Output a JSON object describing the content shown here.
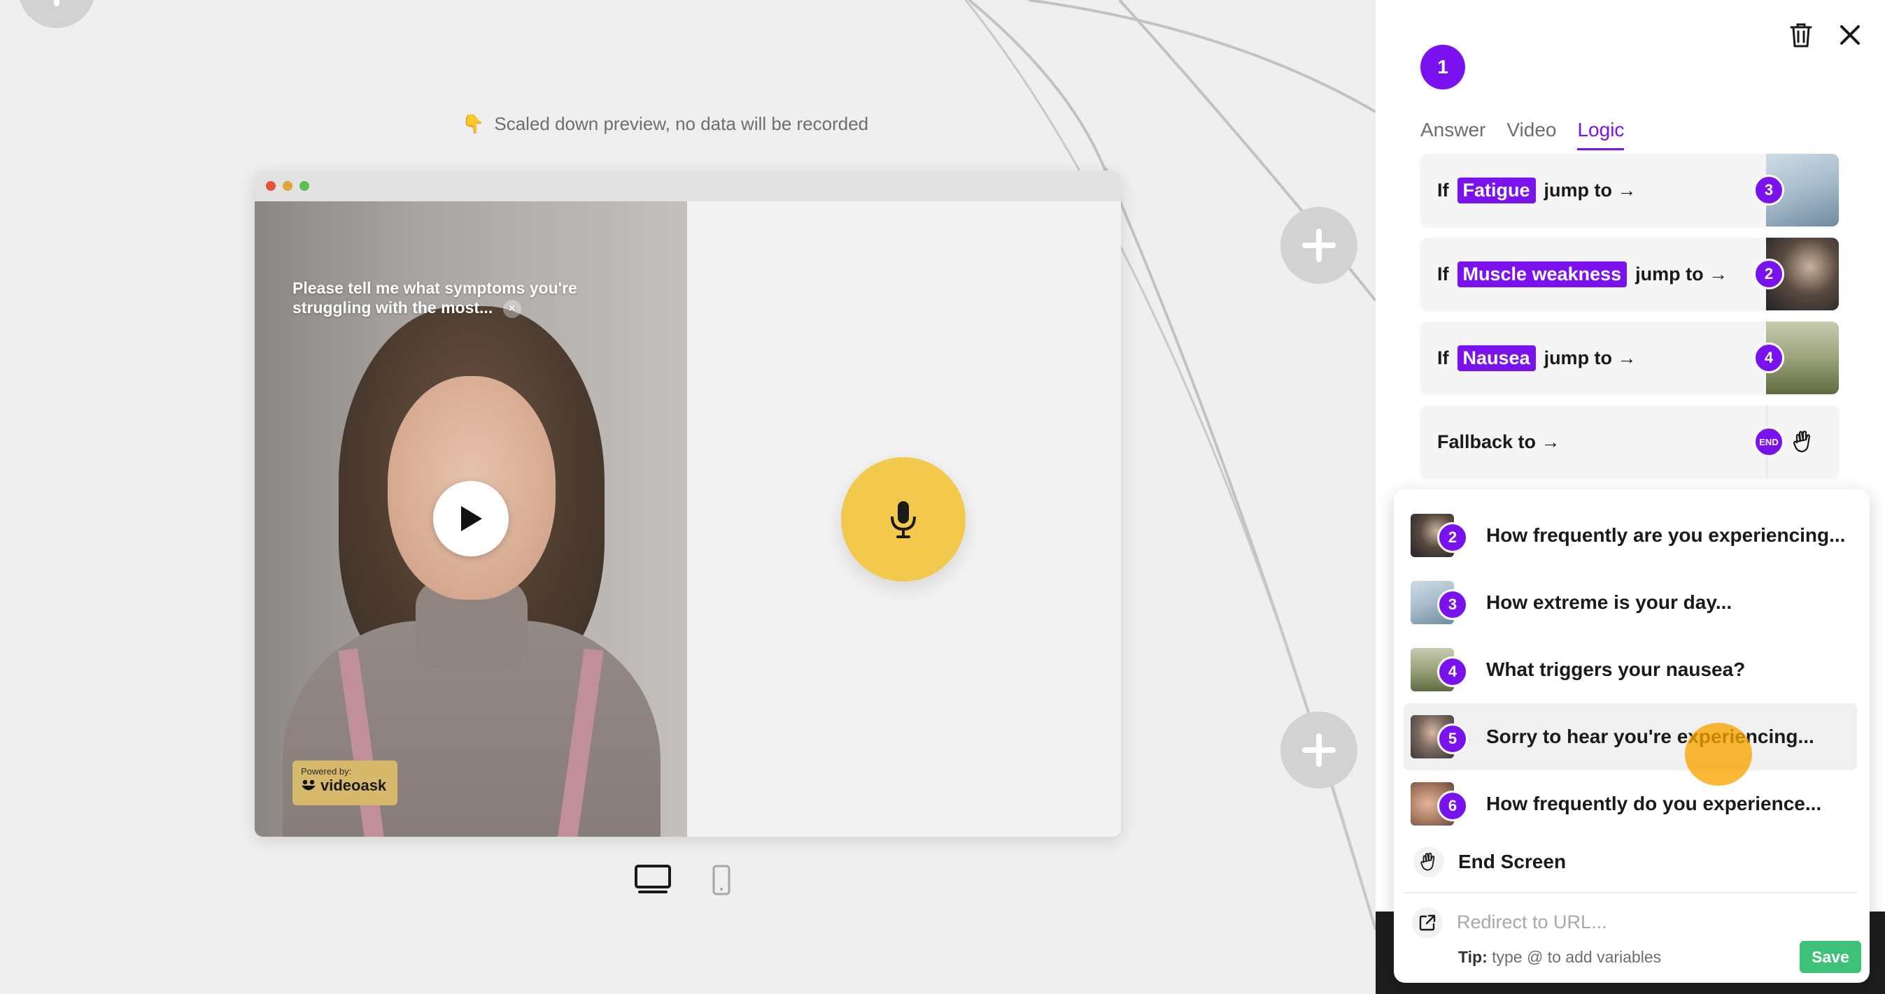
{
  "preview": {
    "note_icon": "pointing-down-hand",
    "note": "Scaled down preview, no data will be recorded",
    "question": "Please tell me what symptoms you're struggling with the most...",
    "question_close": "×",
    "powered_label": "Powered by:",
    "powered_brand": "videoask"
  },
  "panel": {
    "step_number": "1",
    "tabs": [
      {
        "label": "Answer",
        "active": false
      },
      {
        "label": "Video",
        "active": false
      },
      {
        "label": "Logic",
        "active": true
      }
    ],
    "logic_rows": [
      {
        "prefix": "If",
        "condition": "Fatigue",
        "suffix": "jump to →",
        "target": "3"
      },
      {
        "prefix": "If",
        "condition": "Muscle weakness",
        "suffix": "jump to →",
        "target": "2"
      },
      {
        "prefix": "If",
        "condition": "Nausea",
        "suffix": "jump to →",
        "target": "4"
      }
    ],
    "fallback": {
      "label": "Fallback to →",
      "target": "END"
    }
  },
  "dropdown": {
    "items": [
      {
        "number": "2",
        "label": "How frequently are you experiencing..."
      },
      {
        "number": "3",
        "label": "How extreme is your day..."
      },
      {
        "number": "4",
        "label": "What triggers your nausea?"
      },
      {
        "number": "5",
        "label": "Sorry to hear you're experiencing..."
      },
      {
        "number": "6",
        "label": "How frequently do you experience..."
      }
    ],
    "end_screen": "End Screen",
    "redirect_placeholder": "Redirect to URL...",
    "tip_label": "Tip:",
    "tip_text": "type @ to add variables",
    "save_label": "Save"
  },
  "colors": {
    "accent": "#7a12f0",
    "mic": "#f2c94c",
    "save": "#3ec27a"
  }
}
